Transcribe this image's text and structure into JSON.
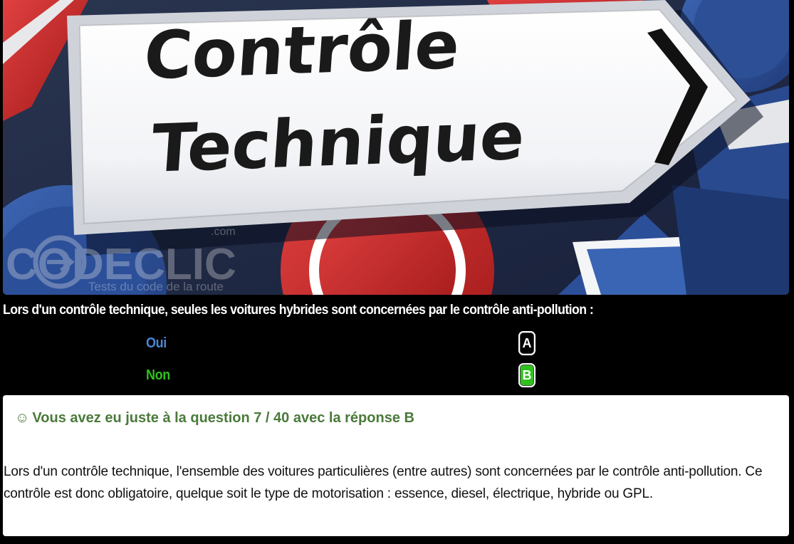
{
  "hero": {
    "sign_line1": "Contrôle",
    "sign_line2": "Technique",
    "watermark_logo": "CODECLIC",
    "watermark_tagline": "Tests du code de la route",
    "watermark_com": ".com"
  },
  "question": {
    "text": "Lors d'un contrôle technique, seules les voitures hybrides sont concernées par le contrôle anti-pollution :",
    "answers": [
      {
        "label": "Oui",
        "key": "A",
        "selected": false,
        "color": "#4a86d4"
      },
      {
        "label": "Non",
        "key": "B",
        "selected": true,
        "color": "#2fc21c"
      }
    ]
  },
  "result": {
    "icon": "☺",
    "title": "Vous avez eu juste à la question 7 / 40 avec la réponse B",
    "explanation": "Lors d'un contrôle technique, l'ensemble des voitures particulières (entre autres) sont concernées par le contrôle anti-pollution. Ce contrôle est donc obligatoire, quelque soit le type de motorisation : essence, diesel, électrique, hybride ou GPL.",
    "title_color": "#4a7a3a"
  }
}
